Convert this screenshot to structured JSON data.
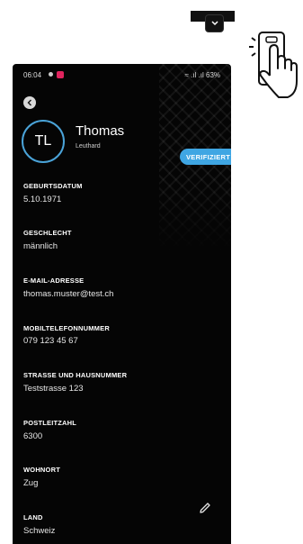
{
  "status_bar": {
    "time": "06:04",
    "right": "≈ .ıl .ıl 63%"
  },
  "profile": {
    "initials": "TL",
    "first_name": "Thomas",
    "last_name": "Leuthard",
    "verified_label": "VERIFIZIERT"
  },
  "fields": [
    {
      "label": "GEBURTSDATUM",
      "value": "5.10.1971"
    },
    {
      "label": "GESCHLECHT",
      "value": "männlich"
    },
    {
      "label": "E-MAIL-ADRESSE",
      "value": "thomas.muster@test.ch"
    },
    {
      "label": "MOBILTELEFONNUMMER",
      "value": "079 123 45 67"
    },
    {
      "label": "STRASSE UND HAUSNUMMER",
      "value": "Teststrasse 123"
    },
    {
      "label": "POSTLEITZAHL",
      "value": "6300"
    },
    {
      "label": "WOHNORT",
      "value": "Zug"
    },
    {
      "label": "LAND",
      "value": "Schweiz"
    }
  ],
  "colors": {
    "accent": "#3fa6e3",
    "background": "#050505"
  }
}
